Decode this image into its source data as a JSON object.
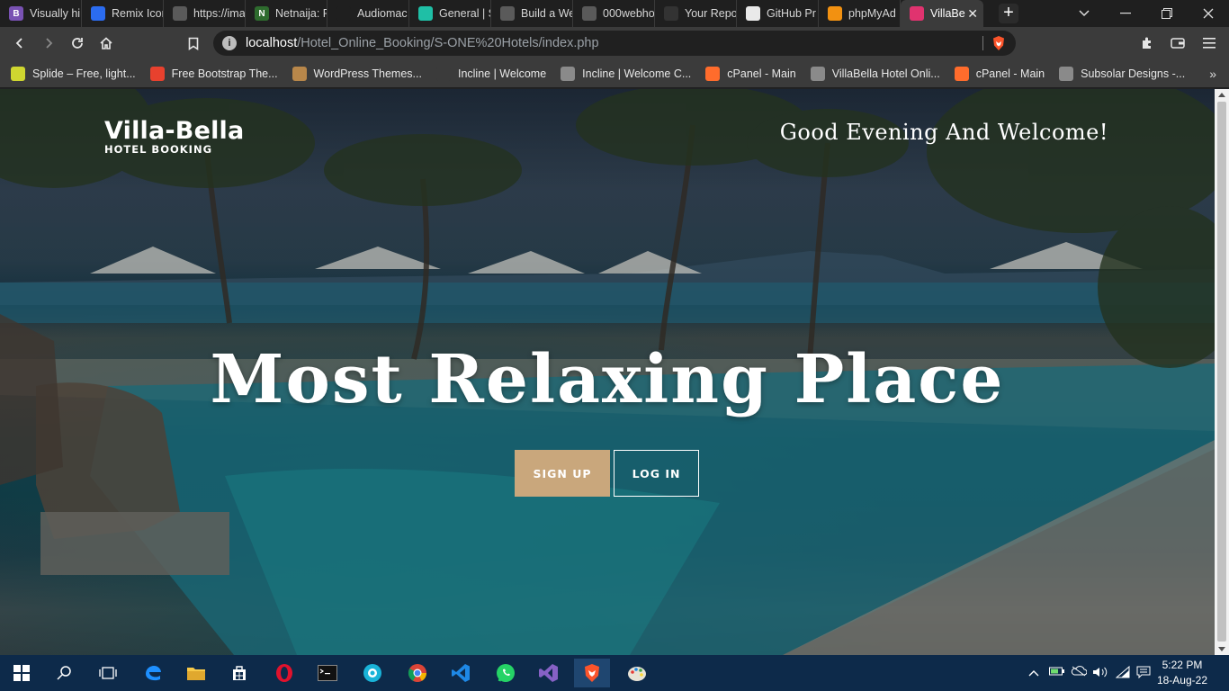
{
  "browser": {
    "tabs": [
      {
        "label": "Visually hi",
        "icon": "bootstrap-icon",
        "color": "#7952b3",
        "glyph": "B"
      },
      {
        "label": "Remix Icon",
        "icon": "remix-icon",
        "color": "#2b6cf0",
        "glyph": ""
      },
      {
        "label": "https://ima",
        "icon": "globe-icon",
        "color": "#5a5a5a",
        "glyph": ""
      },
      {
        "label": "Netnaija: F",
        "icon": "netnaija-icon",
        "color": "#2e6b2e",
        "glyph": "N"
      },
      {
        "label": "Audiomac",
        "icon": "audiomack-icon",
        "color": "#1f1f1f",
        "glyph": ""
      },
      {
        "label": "General | S",
        "icon": "diamond-icon",
        "color": "#1fbfa6",
        "glyph": ""
      },
      {
        "label": "Build a We",
        "icon": "globe-icon",
        "color": "#5a5a5a",
        "glyph": ""
      },
      {
        "label": "000webho",
        "icon": "globe-icon",
        "color": "#5a5a5a",
        "glyph": ""
      },
      {
        "label": "Your Repo",
        "icon": "github-icon",
        "color": "#333333",
        "glyph": ""
      },
      {
        "label": "GitHub Pr",
        "icon": "mog-icon",
        "color": "#e9e9e9",
        "glyph": ""
      },
      {
        "label": "phpMyAd",
        "icon": "phpmyadmin-icon",
        "color": "#f29111",
        "glyph": ""
      },
      {
        "label": "VillaBe",
        "icon": "villabella-icon",
        "color": "#e0336f",
        "glyph": "",
        "active": true
      }
    ],
    "new_tab": "+",
    "address": {
      "host": "localhost",
      "path": "/Hotel_Online_Booking/S-ONE%20Hotels/index.php"
    },
    "bookmarks": [
      {
        "label": "Splide – Free, light...",
        "icon": "splide-icon",
        "color": "#cfd630"
      },
      {
        "label": "Free Bootstrap The...",
        "icon": "s-icon",
        "color": "#e8412e"
      },
      {
        "label": "WordPress Themes...",
        "icon": "wp-themes-icon",
        "color": "#b8874a"
      },
      {
        "label": "Incline | Welcome",
        "icon": "incline-icon",
        "color": "#3b3b3b"
      },
      {
        "label": "Incline | Welcome C...",
        "icon": "globe-icon",
        "color": "#8a8a8a"
      },
      {
        "label": "cPanel - Main",
        "icon": "cpanel-icon",
        "color": "#ff6c2c"
      },
      {
        "label": "VillaBella Hotel Onli...",
        "icon": "globe-icon",
        "color": "#8a8a8a"
      },
      {
        "label": "cPanel - Main",
        "icon": "cpanel-icon",
        "color": "#ff6c2c"
      },
      {
        "label": "Subsolar Designs -...",
        "icon": "globe-icon",
        "color": "#8a8a8a"
      }
    ],
    "bookmarks_more": "»"
  },
  "site": {
    "brand_name": "Villa-Bella",
    "brand_sub": "HOTEL BOOKING",
    "greeting": "Good Evening And Welcome!",
    "hero_title": "Most Relaxing Place",
    "signup_label": "SIGN UP",
    "login_label": "LOG IN",
    "accent": "#c9a77c"
  },
  "taskbar": {
    "time": "5:22 PM",
    "date": "18-Aug-22",
    "apps": [
      "start-icon",
      "search-icon",
      "task-view-icon",
      "edge-icon",
      "file-explorer-icon",
      "store-icon",
      "opera-icon",
      "terminal-icon",
      "ninja-icon",
      "chrome-icon",
      "vscode-icon",
      "whatsapp-icon",
      "visual-studio-icon",
      "brave-icon",
      "paint-icon"
    ]
  }
}
